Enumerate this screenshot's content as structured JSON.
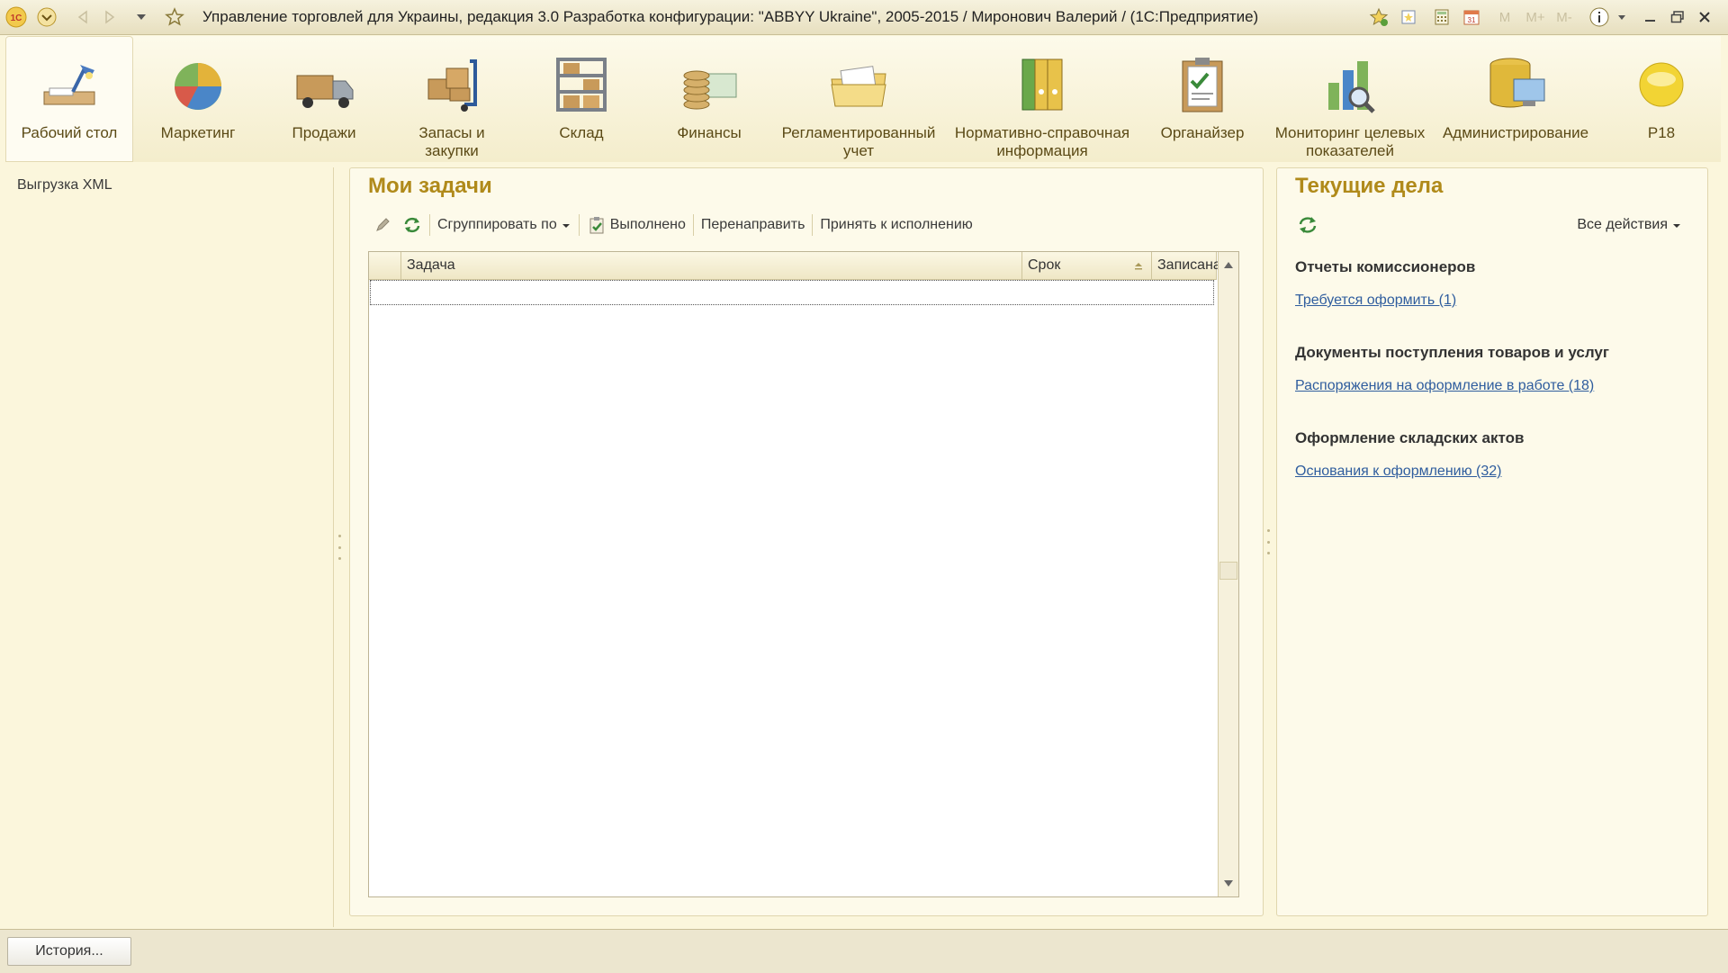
{
  "window": {
    "title": "Управление торговлей для Украины, редакция 3.0 Разработка конфигурации: \"ABBYY Ukraine\", 2005-2015 / Миронович Валерий /   (1С:Предприятие)",
    "logo": "1С",
    "memory_buttons": [
      "M",
      "M+",
      "M-"
    ]
  },
  "sections": [
    {
      "label": "Рабочий стол",
      "icon": "desk-lamp-icon"
    },
    {
      "label": "Маркетинг",
      "icon": "pie-chart-icon"
    },
    {
      "label": "Продажи",
      "icon": "truck-icon"
    },
    {
      "label": "Запасы и закупки",
      "icon": "boxes-cart-icon"
    },
    {
      "label": "Склад",
      "icon": "shelves-icon"
    },
    {
      "label": "Финансы",
      "icon": "coins-icon"
    },
    {
      "label": "Регламентированный учет",
      "icon": "folder-documents-icon"
    },
    {
      "label": "Нормативно-справочная информация",
      "icon": "binders-icon"
    },
    {
      "label": "Органайзер",
      "icon": "clipboard-icon"
    },
    {
      "label": "Мониторинг целевых показателей",
      "icon": "bar-chart-magnifier-icon"
    },
    {
      "label": "Администрирование",
      "icon": "database-computer-icon"
    },
    {
      "label": "P18",
      "icon": "yellow-circle-icon"
    }
  ],
  "left_panel": {
    "items": [
      "Выгрузка XML"
    ]
  },
  "tasks": {
    "title": "Мои задачи",
    "toolbar": {
      "group_by": "Сгруппировать по",
      "done": "Выполнено",
      "redirect": "Перенаправить",
      "accept": "Принять к исполнению"
    },
    "columns": [
      "Задача",
      "Срок",
      "Записана"
    ]
  },
  "current": {
    "title": "Текущие дела",
    "all_actions": "Все действия",
    "groups": [
      {
        "heading": "Отчеты комиссионеров",
        "link": "Требуется оформить (1)"
      },
      {
        "heading": "Документы поступления товаров и услуг",
        "link": "Распоряжения на оформление в работе (18)"
      },
      {
        "heading": "Оформление складских актов",
        "link": "Основания к оформлению (32)"
      }
    ]
  },
  "status": {
    "history_button": "История..."
  },
  "colors": {
    "accent_title": "#b08a1a",
    "link": "#2f5d9e",
    "background": "#fbf6dc"
  }
}
